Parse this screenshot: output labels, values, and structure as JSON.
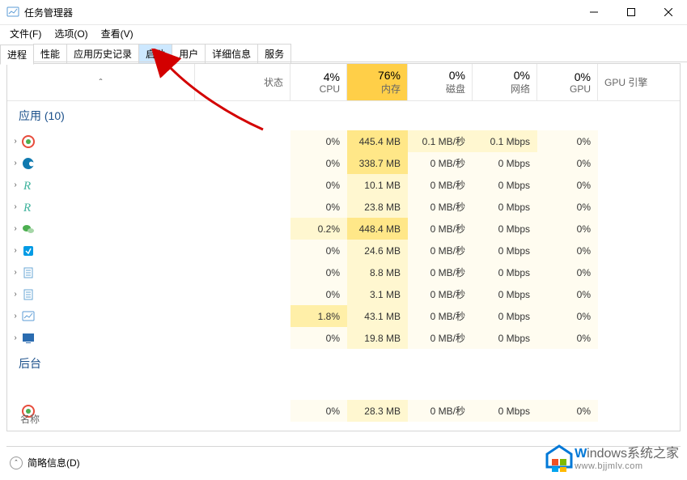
{
  "window": {
    "title": "任务管理器"
  },
  "menubar": [
    {
      "key": "file",
      "label": "文件(F)"
    },
    {
      "key": "options",
      "label": "选项(O)"
    },
    {
      "key": "view",
      "label": "查看(V)"
    }
  ],
  "tabs": [
    {
      "key": "processes",
      "label": "进程",
      "active": true
    },
    {
      "key": "performance",
      "label": "性能"
    },
    {
      "key": "apphistory",
      "label": "应用历史记录"
    },
    {
      "key": "startup",
      "label": "启动",
      "highlight": true
    },
    {
      "key": "users",
      "label": "用户"
    },
    {
      "key": "details",
      "label": "详细信息"
    },
    {
      "key": "services",
      "label": "服务"
    }
  ],
  "columns": {
    "name": "名称",
    "status": "状态",
    "cpu": {
      "pct": "4%",
      "label": "CPU"
    },
    "mem": {
      "pct": "76%",
      "label": "内存"
    },
    "disk": {
      "pct": "0%",
      "label": "磁盘"
    },
    "net": {
      "pct": "0%",
      "label": "网络"
    },
    "gpu": {
      "pct": "0%",
      "label": "GPU"
    },
    "engine": "GPU 引擎"
  },
  "groups": {
    "apps": {
      "label": "应用 (10)"
    },
    "background": {
      "label": "后台"
    }
  },
  "rows_apps": [
    {
      "icon": "chrome-like",
      "iconColor": "#e74c3c",
      "cpu": "0%",
      "mem": "445.4 MB",
      "disk": "0.1 MB/秒",
      "net": "0.1 Mbps",
      "gpu": "0%",
      "memHeat": 3,
      "diskHeat": 1,
      "netHeat": 1
    },
    {
      "icon": "edge",
      "iconColor": "#0f79af",
      "cpu": "0%",
      "mem": "338.7 MB",
      "disk": "0 MB/秒",
      "net": "0 Mbps",
      "gpu": "0%",
      "memHeat": 3
    },
    {
      "icon": "r-letter",
      "iconColor": "#3fb39d",
      "cpu": "0%",
      "mem": "10.1 MB",
      "disk": "0 MB/秒",
      "net": "0 Mbps",
      "gpu": "0%",
      "memHeat": 1
    },
    {
      "icon": "r-letter",
      "iconColor": "#3fb39d",
      "cpu": "0%",
      "mem": "23.8 MB",
      "disk": "0 MB/秒",
      "net": "0 Mbps",
      "gpu": "0%",
      "memHeat": 1
    },
    {
      "icon": "wechat",
      "iconColor": "#4caf50",
      "cpu": "0.2%",
      "mem": "448.4 MB",
      "disk": "0 MB/秒",
      "net": "0 Mbps",
      "gpu": "0%",
      "cpuHeat": 1,
      "memHeat": 3
    },
    {
      "icon": "blue-square",
      "iconColor": "#039be5",
      "cpu": "0%",
      "mem": "24.6 MB",
      "disk": "0 MB/秒",
      "net": "0 Mbps",
      "gpu": "0%",
      "memHeat": 1
    },
    {
      "icon": "notepad",
      "iconColor": "#6aa7d6",
      "cpu": "0%",
      "mem": "8.8 MB",
      "disk": "0 MB/秒",
      "net": "0 Mbps",
      "gpu": "0%",
      "memHeat": 1
    },
    {
      "icon": "notepad",
      "iconColor": "#6aa7d6",
      "cpu": "0%",
      "mem": "3.1 MB",
      "disk": "0 MB/秒",
      "net": "0 Mbps",
      "gpu": "0%",
      "memHeat": 1
    },
    {
      "icon": "taskmgr",
      "iconColor": "#5b9bd5",
      "cpu": "1.8%",
      "mem": "43.1 MB",
      "disk": "0 MB/秒",
      "net": "0 Mbps",
      "gpu": "0%",
      "cpuHeat": 2,
      "memHeat": 1
    },
    {
      "icon": "screen",
      "iconColor": "#2b6cb0",
      "cpu": "0%",
      "mem": "19.8 MB",
      "disk": "0 MB/秒",
      "net": "0 Mbps",
      "gpu": "0%",
      "memHeat": 1
    }
  ],
  "rows_bg": [
    {
      "icon": "chrome-like",
      "iconColor": "#e74c3c",
      "cpu": "0%",
      "mem": "28.3 MB",
      "disk": "0 MB/秒",
      "net": "0 Mbps",
      "gpu": "0%",
      "memHeat": 1,
      "noChevron": true
    }
  ],
  "footer": {
    "fewerDetails": "简略信息(D)"
  },
  "watermark": {
    "brand_w": "W",
    "brand_rest": "indows",
    "brand_suffix": "系统之家",
    "url": "www.bjjmlv.com"
  }
}
